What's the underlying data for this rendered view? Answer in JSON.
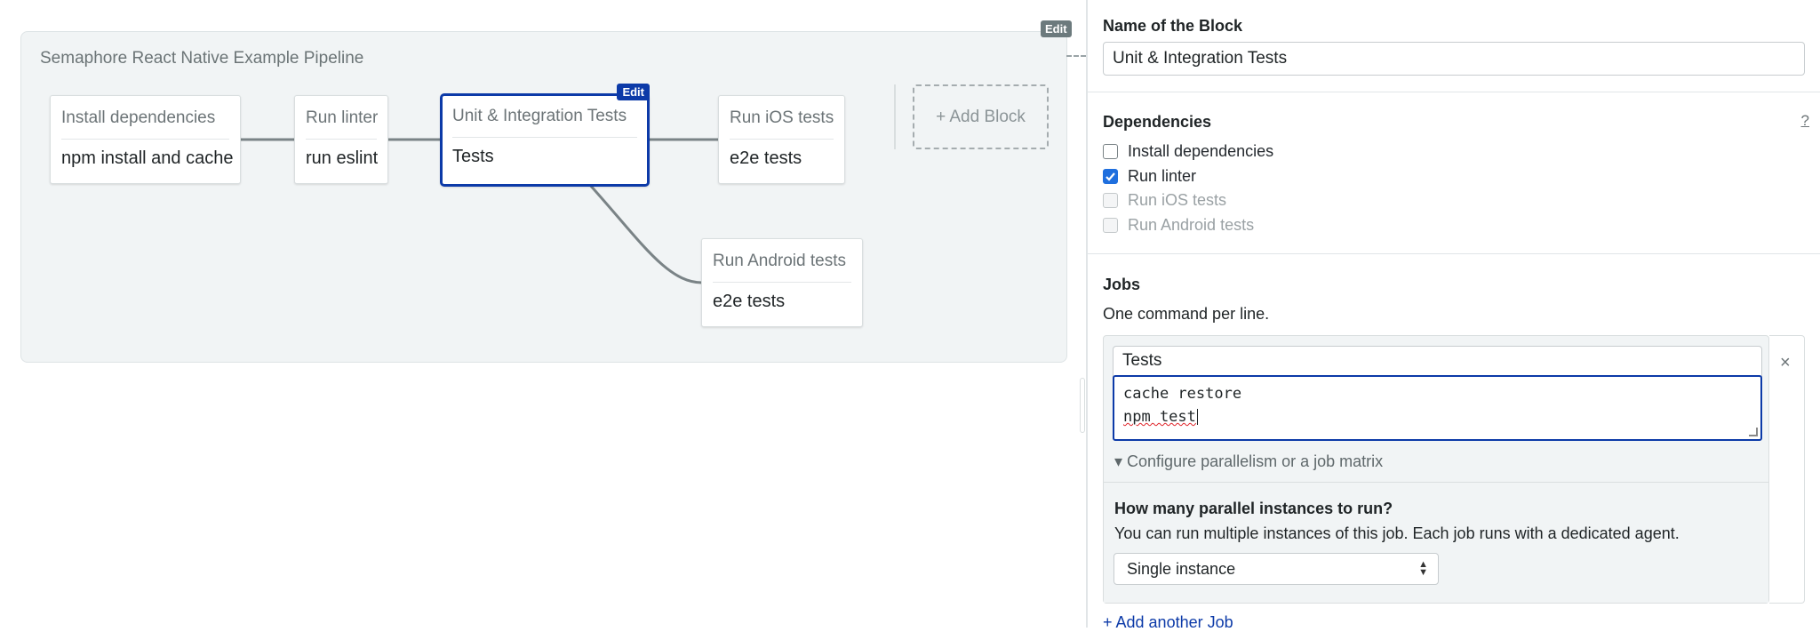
{
  "pipeline": {
    "title": "Semaphore React Native Example Pipeline",
    "edit_label": "Edit",
    "add_block_label": "+ Add Block",
    "blocks": [
      {
        "name": "Install dependencies",
        "job": "npm install and cache"
      },
      {
        "name": "Run linter",
        "job": "run eslint"
      },
      {
        "name": "Unit & Integration Tests",
        "job": "Tests",
        "edit_label": "Edit"
      },
      {
        "name": "Run iOS tests",
        "job": "e2e tests"
      },
      {
        "name": "Run Android tests",
        "job": "e2e tests"
      }
    ]
  },
  "panel": {
    "block_name_label": "Name of the Block",
    "block_name_value": "Unit & Integration Tests",
    "dependencies_label": "Dependencies",
    "help_label": "?",
    "dependencies": [
      {
        "label": "Install dependencies",
        "checked": false,
        "disabled": false
      },
      {
        "label": "Run linter",
        "checked": true,
        "disabled": false
      },
      {
        "label": "Run iOS tests",
        "checked": false,
        "disabled": true
      },
      {
        "label": "Run Android tests",
        "checked": false,
        "disabled": true
      }
    ],
    "jobs_label": "Jobs",
    "jobs_hint": "One command per line.",
    "job": {
      "name": "Tests",
      "commands": [
        "cache restore",
        "npm test"
      ],
      "close_label": "×",
      "config_toggle": "▾ Configure parallelism or a job matrix",
      "parallel_question": "How many parallel instances to run?",
      "parallel_description": "You can run multiple instances of this job. Each job runs with a dedicated agent.",
      "parallel_select_value": "Single instance"
    },
    "add_job_label": "+ Add another Job"
  },
  "colors": {
    "accent": "#0c3aa8",
    "checkbox_checked": "#1f6fde",
    "canvas_bg": "#f1f4f5"
  }
}
